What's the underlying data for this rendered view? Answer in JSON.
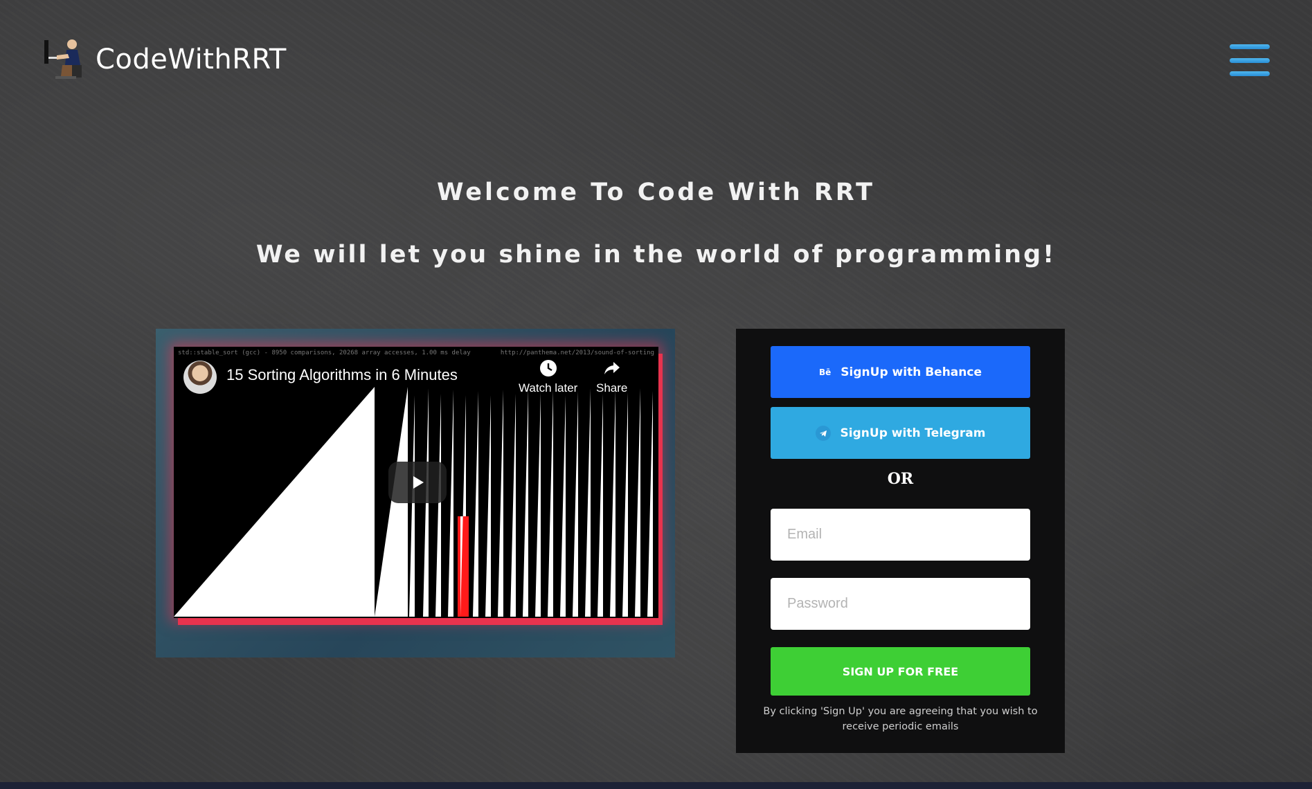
{
  "header": {
    "logo_text": "CodeWithRRT",
    "menu_icon": "hamburger-icon",
    "accent_color": "#3aa7e6"
  },
  "hero": {
    "title": "Welcome To Code With RRT",
    "subtitle": "We will let you shine in the world of programming!"
  },
  "video": {
    "title": "15 Sorting Algorithms in 6 Minutes",
    "meta_left": "std::stable_sort (gcc) - 8950 comparisons, 20268 array accesses, 1.00 ms delay",
    "meta_right": "http://panthema.net/2013/sound-of-sorting",
    "watch_later_label": "Watch later",
    "share_label": "Share",
    "play_icon": "play-icon"
  },
  "signup": {
    "behance_icon_text": "Bē",
    "behance_label": "SignUp with Behance",
    "behance_color": "#1b69fa",
    "telegram_label": "SignUp with Telegram",
    "telegram_color": "#2fa9e1",
    "or_label": "OR",
    "email_placeholder": "Email",
    "password_placeholder": "Password",
    "submit_label": "SIGN UP FOR FREE",
    "submit_color": "#3ecf35",
    "terms": "By clicking 'Sign Up' you are agreeing that you wish to receive periodic emails"
  }
}
